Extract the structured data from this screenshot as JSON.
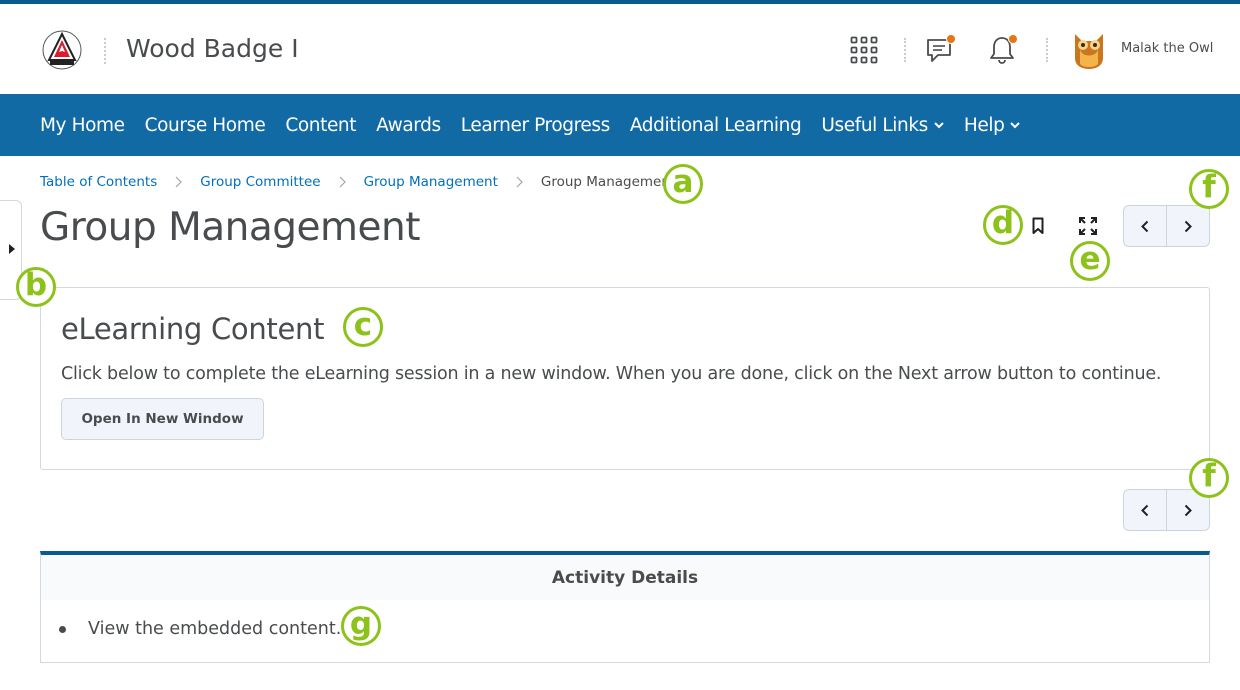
{
  "header": {
    "course_title": "Wood Badge I",
    "user_name": "Malak the Owl",
    "icons": [
      "apps-grid-icon",
      "message-alert-icon",
      "notification-bell-icon"
    ],
    "notification_color": "#e87511"
  },
  "nav": {
    "items": [
      {
        "label": "My Home",
        "has_dropdown": false
      },
      {
        "label": "Course Home",
        "has_dropdown": false
      },
      {
        "label": "Content",
        "has_dropdown": false
      },
      {
        "label": "Awards",
        "has_dropdown": false
      },
      {
        "label": "Learner Progress",
        "has_dropdown": false
      },
      {
        "label": "Additional Learning",
        "has_dropdown": false
      },
      {
        "label": "Useful Links",
        "has_dropdown": true
      },
      {
        "label": "Help",
        "has_dropdown": true
      }
    ],
    "background": "#126aa5"
  },
  "breadcrumbs": {
    "items": [
      "Table of Contents",
      "Group Committee",
      "Group Management"
    ],
    "current": "Group Management"
  },
  "page": {
    "title": "Group Management"
  },
  "content": {
    "title": "eLearning Content",
    "description": "Click below to complete the eLearning session in a new window. When you are done, click on the Next arrow button to continue.",
    "open_button": "Open In New Window"
  },
  "activity": {
    "title": "Activity Details",
    "items": [
      "View the embedded content."
    ]
  },
  "callouts": {
    "a": "a",
    "b": "b",
    "c": "c",
    "d": "d",
    "e": "e",
    "f": "f",
    "g": "g",
    "color": "#8cc219"
  }
}
